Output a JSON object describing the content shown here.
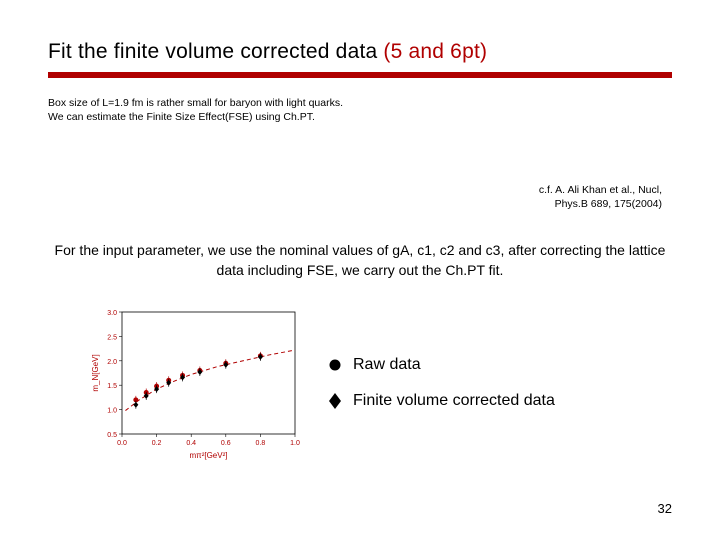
{
  "title": {
    "main": "Fit the finite volume corrected data ",
    "paren": "(5 and 6pt)"
  },
  "note": {
    "line1": "Box size of L=1.9 fm is rather small for baryon with light quarks.",
    "line2": "We can estimate the Finite Size Effect(FSE) using Ch.PT."
  },
  "citation": {
    "line1": "c.f. A. Ali Khan et al., Nucl,",
    "line2": "Phys.B 689, 175(2004)"
  },
  "body": "For the input parameter, we use the nominal values of gA, c1, c2 and c3, after correcting the lattice data including FSE, we carry out the Ch.PT fit.",
  "legend": {
    "raw": "Raw data",
    "fse": "Finite volume corrected data"
  },
  "page": "32",
  "chart_data": {
    "type": "scatter",
    "title": "",
    "xlabel": "mπ²[GeV²]",
    "ylabel": "m_N[GeV]",
    "xlim": [
      0,
      1.0
    ],
    "ylim": [
      0.5,
      3.0
    ],
    "yticks": [
      0.5,
      1.0,
      1.5,
      2.0,
      2.5,
      3.0
    ],
    "series": [
      {
        "name": "Raw data",
        "marker": "circle",
        "color": "#b00000",
        "points": [
          {
            "x": 0.08,
            "y": 1.2
          },
          {
            "x": 0.14,
            "y": 1.35
          },
          {
            "x": 0.2,
            "y": 1.48
          },
          {
            "x": 0.27,
            "y": 1.6
          },
          {
            "x": 0.35,
            "y": 1.7
          },
          {
            "x": 0.45,
            "y": 1.8
          },
          {
            "x": 0.6,
            "y": 1.95
          },
          {
            "x": 0.8,
            "y": 2.1
          }
        ]
      },
      {
        "name": "Finite volume corrected data",
        "marker": "diamond",
        "color": "#000000",
        "points": [
          {
            "x": 0.08,
            "y": 1.1
          },
          {
            "x": 0.14,
            "y": 1.28
          },
          {
            "x": 0.2,
            "y": 1.42
          },
          {
            "x": 0.27,
            "y": 1.55
          },
          {
            "x": 0.35,
            "y": 1.66
          },
          {
            "x": 0.45,
            "y": 1.77
          },
          {
            "x": 0.6,
            "y": 1.92
          },
          {
            "x": 0.8,
            "y": 2.08
          }
        ]
      }
    ],
    "fit_curve": {
      "color": "#b00000",
      "dash": "4,3",
      "points": [
        {
          "x": 0.02,
          "y": 0.98
        },
        {
          "x": 0.1,
          "y": 1.2
        },
        {
          "x": 0.2,
          "y": 1.42
        },
        {
          "x": 0.3,
          "y": 1.58
        },
        {
          "x": 0.4,
          "y": 1.72
        },
        {
          "x": 0.55,
          "y": 1.88
        },
        {
          "x": 0.7,
          "y": 2.0
        },
        {
          "x": 0.85,
          "y": 2.12
        },
        {
          "x": 1.0,
          "y": 2.22
        }
      ]
    }
  }
}
